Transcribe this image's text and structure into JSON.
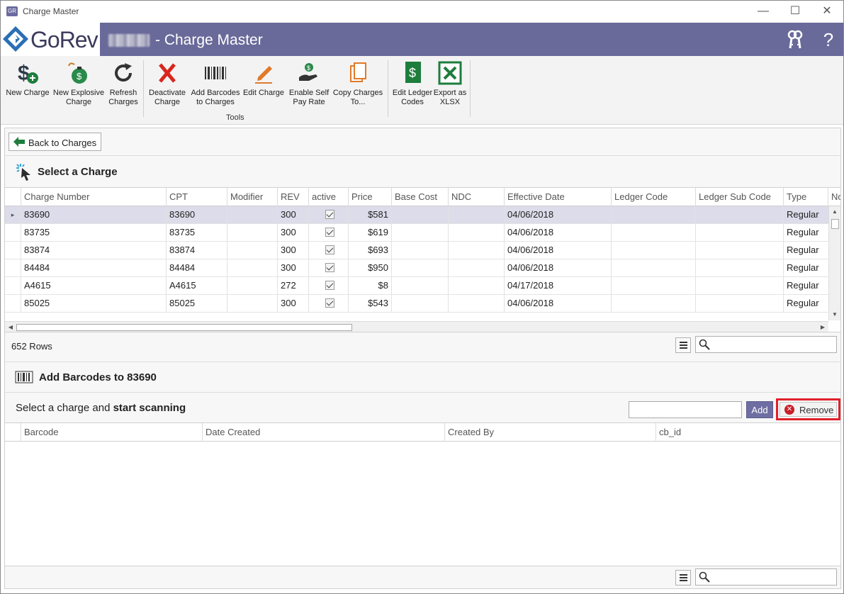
{
  "window": {
    "title": "Charge Master",
    "minimize": "—",
    "maximize": "☐",
    "close": "✕"
  },
  "header": {
    "logo_text": "GoRev",
    "title": "- Charge Master",
    "keys_icon": "keys-icon",
    "help_icon": "?"
  },
  "ribbon": {
    "tools": [
      {
        "label": "New Charge",
        "icon": "dollar-plus-icon"
      },
      {
        "label": "New Explosive Charge",
        "icon": "bomb-dollar-icon"
      },
      {
        "label": "Refresh Charges",
        "icon": "refresh-icon"
      },
      {
        "label": "Deactivate Charge",
        "icon": "red-x-icon"
      },
      {
        "label": "Add Barcodes to Charges",
        "icon": "barcode-icon"
      },
      {
        "label": "Edit Charge",
        "icon": "pencil-icon"
      },
      {
        "label": "Enable Self Pay Rate",
        "icon": "hand-coins-icon"
      },
      {
        "label": "Copy Charges To...",
        "icon": "copy-docs-icon"
      },
      {
        "label": "Edit Ledger Codes",
        "icon": "ledger-dollar-icon"
      },
      {
        "label": "Export as XLSX",
        "icon": "excel-icon"
      }
    ],
    "group_label": "Tools"
  },
  "back_button": "Back to Charges",
  "select_section": {
    "title": "Select a Charge",
    "columns": [
      "Charge Number",
      "CPT",
      "Modifier",
      "REV",
      "active",
      "Price",
      "Base Cost",
      "NDC",
      "Effective Date",
      "Ledger Code",
      "Ledger Sub Code",
      "Type",
      "No"
    ],
    "rows": [
      {
        "charge_number": "83690",
        "cpt": "83690",
        "modifier": "",
        "rev": "300",
        "active": true,
        "price": "$581",
        "base_cost": "",
        "ndc": "",
        "effective_date": "04/06/2018",
        "ledger_code": "",
        "ledger_sub_code": "",
        "type": "Regular"
      },
      {
        "charge_number": "83735",
        "cpt": "83735",
        "modifier": "",
        "rev": "300",
        "active": true,
        "price": "$619",
        "base_cost": "",
        "ndc": "",
        "effective_date": "04/06/2018",
        "ledger_code": "",
        "ledger_sub_code": "",
        "type": "Regular"
      },
      {
        "charge_number": "83874",
        "cpt": "83874",
        "modifier": "",
        "rev": "300",
        "active": true,
        "price": "$693",
        "base_cost": "",
        "ndc": "",
        "effective_date": "04/06/2018",
        "ledger_code": "",
        "ledger_sub_code": "",
        "type": "Regular"
      },
      {
        "charge_number": "84484",
        "cpt": "84484",
        "modifier": "",
        "rev": "300",
        "active": true,
        "price": "$950",
        "base_cost": "",
        "ndc": "",
        "effective_date": "04/06/2018",
        "ledger_code": "",
        "ledger_sub_code": "",
        "type": "Regular"
      },
      {
        "charge_number": "A4615",
        "cpt": "A4615",
        "modifier": "",
        "rev": "272",
        "active": true,
        "price": "$8",
        "base_cost": "",
        "ndc": "",
        "effective_date": "04/17/2018",
        "ledger_code": "",
        "ledger_sub_code": "",
        "type": "Regular"
      },
      {
        "charge_number": "85025",
        "cpt": "85025",
        "modifier": "",
        "rev": "300",
        "active": true,
        "price": "$543",
        "base_cost": "",
        "ndc": "",
        "effective_date": "04/06/2018",
        "ledger_code": "",
        "ledger_sub_code": "",
        "type": "Regular"
      }
    ],
    "row_count": "652 Rows",
    "search_placeholder": ""
  },
  "barcode_section": {
    "title": "Add Barcodes to 83690",
    "prompt_prefix": "Select a charge and ",
    "prompt_bold": "start scanning",
    "scan_value": "",
    "add_label": "Add",
    "remove_label": "Remove",
    "columns": [
      "Barcode",
      "Date Created",
      "Created By",
      "cb_id"
    ],
    "search_placeholder": ""
  },
  "colors": {
    "header_bg": "#69699a",
    "highlight": "#e0202a",
    "selected_row": "#dcdcea"
  }
}
